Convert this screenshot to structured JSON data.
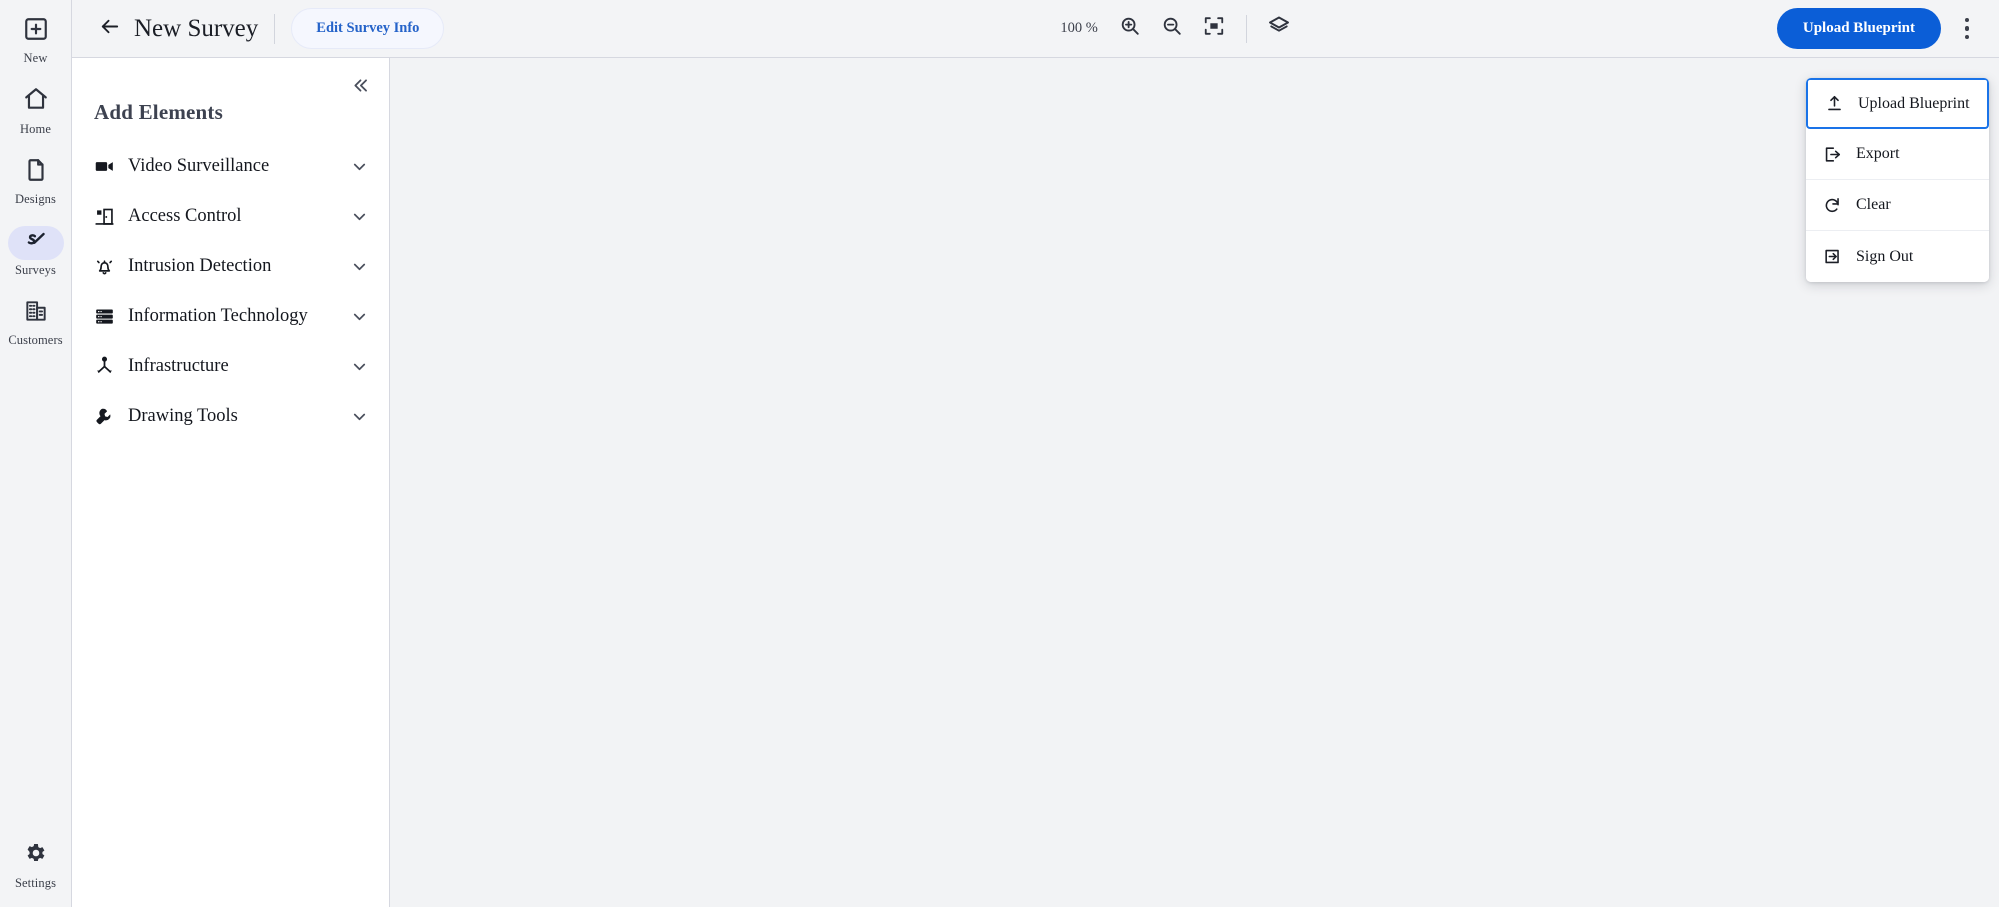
{
  "nav": {
    "items": [
      {
        "label": "New",
        "icon": "plus-square-icon",
        "active": false
      },
      {
        "label": "Home",
        "icon": "home-icon",
        "active": false
      },
      {
        "label": "Designs",
        "icon": "document-icon",
        "active": false
      },
      {
        "label": "Surveys",
        "icon": "survey-check-icon",
        "active": true
      },
      {
        "label": "Customers",
        "icon": "building-icon",
        "active": false
      }
    ],
    "bottom": {
      "label": "Settings",
      "icon": "gear-icon"
    }
  },
  "header": {
    "back_icon": "arrow-left-icon",
    "title": "New Survey",
    "edit_info_label": "Edit Survey Info",
    "zoom_level": "100 %",
    "zoom_in_icon": "zoom-in-icon",
    "zoom_out_icon": "zoom-out-icon",
    "fit_screen_icon": "fit-to-screen-icon",
    "layers_icon": "layers-icon",
    "upload_blueprint_label": "Upload Blueprint",
    "kebab_icon": "more-vertical-icon"
  },
  "panel": {
    "collapse_icon": "chevrons-left-icon",
    "title": "Add Elements",
    "elements": [
      {
        "label": "Video Surveillance",
        "icon": "video-camera-icon",
        "chevron": "chevron-down-icon"
      },
      {
        "label": "Access Control",
        "icon": "door-lock-icon",
        "chevron": "chevron-down-icon"
      },
      {
        "label": "Intrusion Detection",
        "icon": "alarm-bell-icon",
        "chevron": "chevron-down-icon"
      },
      {
        "label": "Information Technology",
        "icon": "server-rack-icon",
        "chevron": "chevron-down-icon"
      },
      {
        "label": "Infrastructure",
        "icon": "network-node-icon",
        "chevron": "chevron-down-icon"
      },
      {
        "label": "Drawing Tools",
        "icon": "wrench-icon",
        "chevron": "chevron-down-icon"
      }
    ]
  },
  "menu": {
    "items": [
      {
        "label": "Upload Blueprint",
        "icon": "upload-icon",
        "focused": true
      },
      {
        "label": "Export",
        "icon": "export-icon",
        "focused": false
      },
      {
        "label": "Clear",
        "icon": "refresh-icon",
        "focused": false
      },
      {
        "label": "Sign Out",
        "icon": "sign-out-icon",
        "focused": false
      }
    ]
  },
  "colors": {
    "accent": "#0b5ed7",
    "focus": "#1a73e8",
    "rail_bg": "#f3f4f6",
    "canvas_bg": "#f2f3f5",
    "active_pill": "#dfe2f8"
  }
}
